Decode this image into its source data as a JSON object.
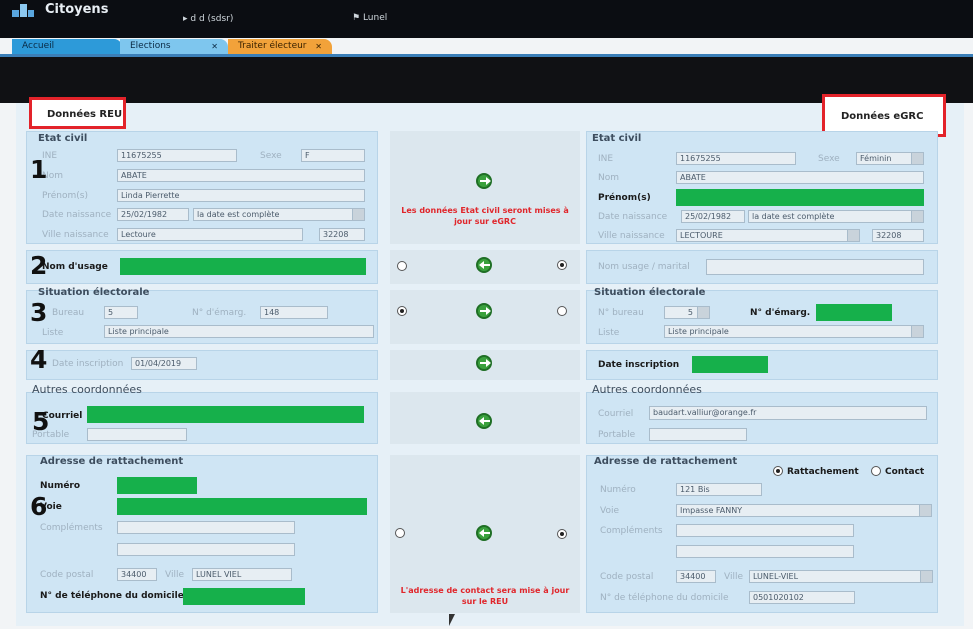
{
  "header": {
    "app_title": "Citoyens",
    "context_left": "▸ d d (sdsr)",
    "context_right": "Lunel"
  },
  "tabs": [
    {
      "label": "Accueil",
      "closable": false,
      "color": "#2d9ad9"
    },
    {
      "label": "Elections",
      "closable": true,
      "close": "✕",
      "color": "#7ec6ee"
    },
    {
      "label": "Traiter électeur",
      "closable": true,
      "close": "✕",
      "color": "#f2a23a",
      "active": true
    }
  ],
  "headers": {
    "left": "Données REU",
    "right": "Données eGRC"
  },
  "step_numbers": [
    "1",
    "2",
    "3",
    "4",
    "5",
    "6"
  ],
  "left": {
    "etat_civil": {
      "title": "Etat civil",
      "ine_label": "INE",
      "ine_value": "11675255",
      "sexe_label": "Sexe",
      "sexe_value": "F",
      "nom_label": "Nom",
      "nom_value": "ABATE",
      "prenoms_label": "Prénom(s)",
      "prenoms_value": "Linda Pierrette",
      "date_naissance_label": "Date naissance",
      "date_naissance_value": "25/02/1982",
      "date_complete_value": "la date est complète",
      "ville_naissance_label": "Ville naissance",
      "ville_naissance_value": "Lectoure",
      "code_value": "32208"
    },
    "nom_usage_label": "Nom d'usage",
    "situation": {
      "title": "Situation électorale",
      "bureau_label": "Bureau",
      "bureau_value": "5",
      "emarg_label": "N° d'émarg.",
      "emarg_value": "148",
      "liste_label": "Liste",
      "liste_value": "Liste principale"
    },
    "inscription": {
      "label": "Date inscription",
      "value": "01/04/2019"
    },
    "autres": {
      "title": "Autres coordonnées",
      "courriel_label": "Courriel",
      "portable_label": "Portable",
      "portable_value": ""
    },
    "adresse": {
      "title": "Adresse de rattachement",
      "numero_label": "Numéro",
      "voie_label": "Voie",
      "complements_label": "Compléments",
      "complement1_value": "",
      "complement2_value": "",
      "code_postal_label": "Code postal",
      "code_postal_value": "34400",
      "ville_label": "Ville",
      "ville_value": "LUNEL VIEL",
      "telephone_label": "N° de téléphone du domicile"
    }
  },
  "center": {
    "etat_civil_msg": "Les données Etat civil seront mises à jour sur eGRC",
    "adresse_msg": "L'adresse de contact sera mise à jour sur le REU"
  },
  "right": {
    "etat_civil": {
      "title": "Etat civil",
      "ine_label": "INE",
      "ine_value": "11675255",
      "sexe_label": "Sexe",
      "sexe_value": "Féminin",
      "nom_label": "Nom",
      "nom_value": "ABATE",
      "prenoms_label": "Prénom(s)",
      "date_naissance_label": "Date naissance",
      "date_naissance_value": "25/02/1982",
      "date_complete_value": "la date est complète",
      "ville_naissance_label": "Ville naissance",
      "ville_naissance_value": "LECTOURE",
      "code_value": "32208"
    },
    "nom_usage_label": "Nom usage / marital",
    "nom_usage_value": "",
    "situation": {
      "title": "Situation électorale",
      "bureau_label": "N° bureau",
      "bureau_value": "5",
      "emarg_label": "N° d'émarg.",
      "liste_label": "Liste",
      "liste_value": "Liste principale"
    },
    "inscription": {
      "label": "Date inscription"
    },
    "autres": {
      "title": "Autres coordonnées",
      "courriel_label": "Courriel",
      "courriel_value": "baudart.valliur@orange.fr",
      "portable_label": "Portable",
      "portable_value": ""
    },
    "adresse": {
      "title": "Adresse de rattachement",
      "rattachement_label": "Rattachement",
      "contact_label": "Contact",
      "numero_label": "Numéro",
      "numero_value": "121 Bis",
      "voie_label": "Voie",
      "voie_value": "Impasse FANNY",
      "complements_label": "Compléments",
      "complement1_value": "",
      "complement2_value": "",
      "code_postal_label": "Code postal",
      "code_postal_value": "34400",
      "ville_label": "Ville",
      "ville_value": "LUNEL-VIEL",
      "telephone_label": "N° de téléphone du domicile",
      "telephone_value": "0501020102"
    }
  },
  "colors": {
    "redacted": "#16b04b",
    "highlight_box": "#e3232a",
    "panel": "#cfe5f4"
  }
}
